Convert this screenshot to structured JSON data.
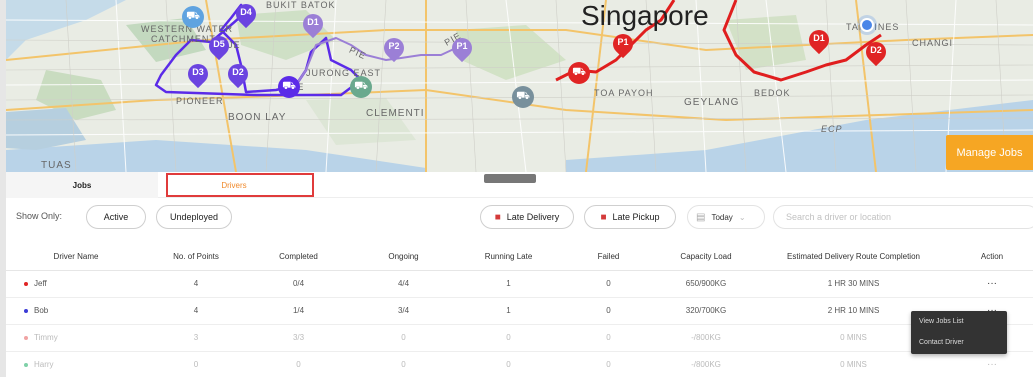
{
  "map": {
    "labels": {
      "singapore": "Singapore",
      "bukit_batok": "BUKIT BATOK",
      "western_water": "WESTERN WATER",
      "catchment": "CATCHMENT",
      "jurong_east": "JURONG EAST",
      "pioneer": "PIONEER",
      "boon_lay": "BOON LAY",
      "clementi": "CLEMENTI",
      "toa_payoh": "TOA PAYOH",
      "geylang": "GEYLANG",
      "bedok": "BEDOK",
      "tampines": "TAMPINES",
      "changi": "CHANGI",
      "tuas": "TUAS",
      "pie": "PIE",
      "pie2": "PIE",
      "ecp": "ECP",
      "aye": "AYE",
      "kje": "KJE"
    },
    "pins": {
      "d1_purple": "D1",
      "d2_purple": "D2",
      "d3_purple": "D3",
      "d4_purple": "D4",
      "d5_purple": "D5",
      "p1_purple": "P1",
      "p2_purple": "P2",
      "p1_red": "P1",
      "d1_red": "D1",
      "d2_red": "D2"
    },
    "colors": {
      "purple_route": "#5b2be8",
      "lavender_route": "#9b7fd6",
      "red_route": "#e01e1e",
      "pin_purple": "#6b44e0",
      "pin_red": "#e02424",
      "truck_grey": "#78909c"
    },
    "manage_jobs_label": "Manage Jobs"
  },
  "tabs": {
    "jobs": "Jobs",
    "drivers": "Drivers"
  },
  "filters": {
    "show_only": "Show Only:",
    "active": "Active",
    "undeployed": "Undeployed",
    "late_delivery": "Late Delivery",
    "late_pickup": "Late Pickup",
    "date": "Today",
    "search_placeholder": "Search a driver or location"
  },
  "table": {
    "headers": [
      "Driver Name",
      "No. of Points",
      "Completed",
      "Ongoing",
      "Running Late",
      "Failed",
      "Capacity Load",
      "Estimated Delivery Route Completion",
      "Action"
    ],
    "rows": [
      {
        "name": "Jeff",
        "dot": "#e02424",
        "points": "4",
        "completed": "0/4",
        "ongoing": "4/4",
        "late": "1",
        "failed": "0",
        "capacity": "650/900KG",
        "eta": "1 HR 30 MINS",
        "action": "···"
      },
      {
        "name": "Bob",
        "dot": "#3b3bd6",
        "points": "4",
        "completed": "1/4",
        "ongoing": "3/4",
        "late": "1",
        "failed": "0",
        "capacity": "320/700KG",
        "eta": "2 HR 10 MINS",
        "action": "···"
      },
      {
        "name": "Timmy",
        "dot": "#f0a3a3",
        "points": "3",
        "completed": "3/3",
        "ongoing": "0",
        "late": "0",
        "failed": "0",
        "capacity": "-/800KG",
        "eta": "0 MINS",
        "action": "···"
      },
      {
        "name": "Harry",
        "dot": "#7fd1a8",
        "points": "0",
        "completed": "0",
        "ongoing": "0",
        "late": "0",
        "failed": "0",
        "capacity": "-/800KG",
        "eta": "0 MINS",
        "action": "···"
      }
    ]
  },
  "context_menu": {
    "view_jobs": "View Jobs List",
    "contact_driver": "Contact Driver"
  }
}
